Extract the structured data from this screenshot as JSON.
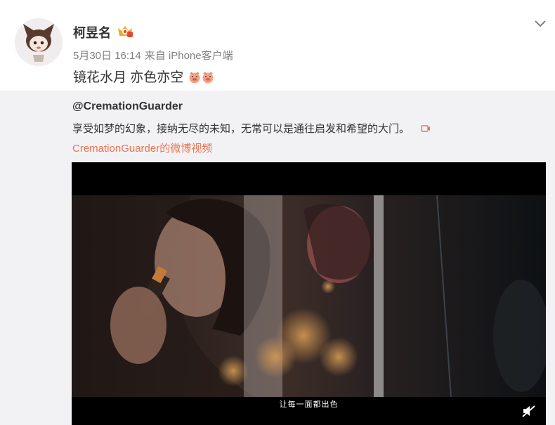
{
  "post": {
    "username": "柯昱名",
    "date": "5月30日 16:14",
    "source": "来自 iPhone客户端",
    "text": "镜花水月 亦色亦空"
  },
  "repost": {
    "author": "@CremationGuarder",
    "text": "享受如梦的幻象，接纳无尽的未知，无常可以是通往启发和希望的大门。",
    "video_source": "CremationGuarder的微博视频"
  },
  "video": {
    "subtitle": "让每一面都出色"
  },
  "icons": {
    "more": "chevron-down-icon",
    "badge": "vip-badge-icon",
    "emoji": "pig-face-emoji",
    "video_link": "video-camera-icon",
    "mute": "speaker-muted-icon"
  },
  "colors": {
    "link": "#eb7350",
    "repost_bg": "#f2f2f5",
    "text": "#333333",
    "meta": "#808080"
  }
}
